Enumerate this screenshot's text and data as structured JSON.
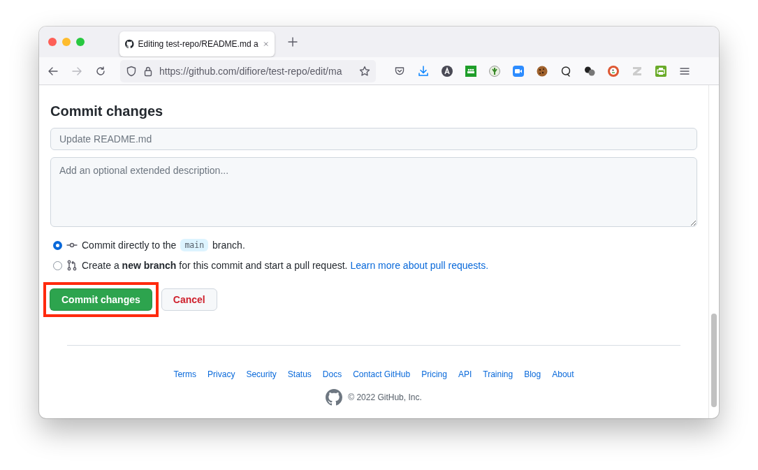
{
  "browser": {
    "tab": {
      "title": "Editing test-repo/README.md a",
      "selected": true
    },
    "url": "https://github.com/difiore/test-repo/edit/ma"
  },
  "commit": {
    "heading": "Commit changes",
    "summary": {
      "placeholder": "Update README.md"
    },
    "description": {
      "placeholder": "Add an optional extended description..."
    },
    "options": [
      {
        "kind": "direct",
        "selected": true,
        "text_before": "Commit directly to the",
        "branch": "main",
        "text_after": "branch."
      },
      {
        "kind": "new_branch",
        "selected": false,
        "text": "Create a **new branch** for this commit and start a pull request.",
        "link": "Learn more about pull requests."
      }
    ],
    "buttons": [
      {
        "kind": "primary",
        "label": "Commit changes",
        "highlighted": true
      },
      {
        "kind": "cancel",
        "label": "Cancel",
        "highlighted": false
      }
    ]
  },
  "footer": {
    "links": [
      "Terms",
      "Privacy",
      "Security",
      "Status",
      "Docs",
      "Contact GitHub",
      "Pricing",
      "API",
      "Training",
      "Blog",
      "About"
    ],
    "copyright": "© 2022 GitHub, Inc."
  }
}
